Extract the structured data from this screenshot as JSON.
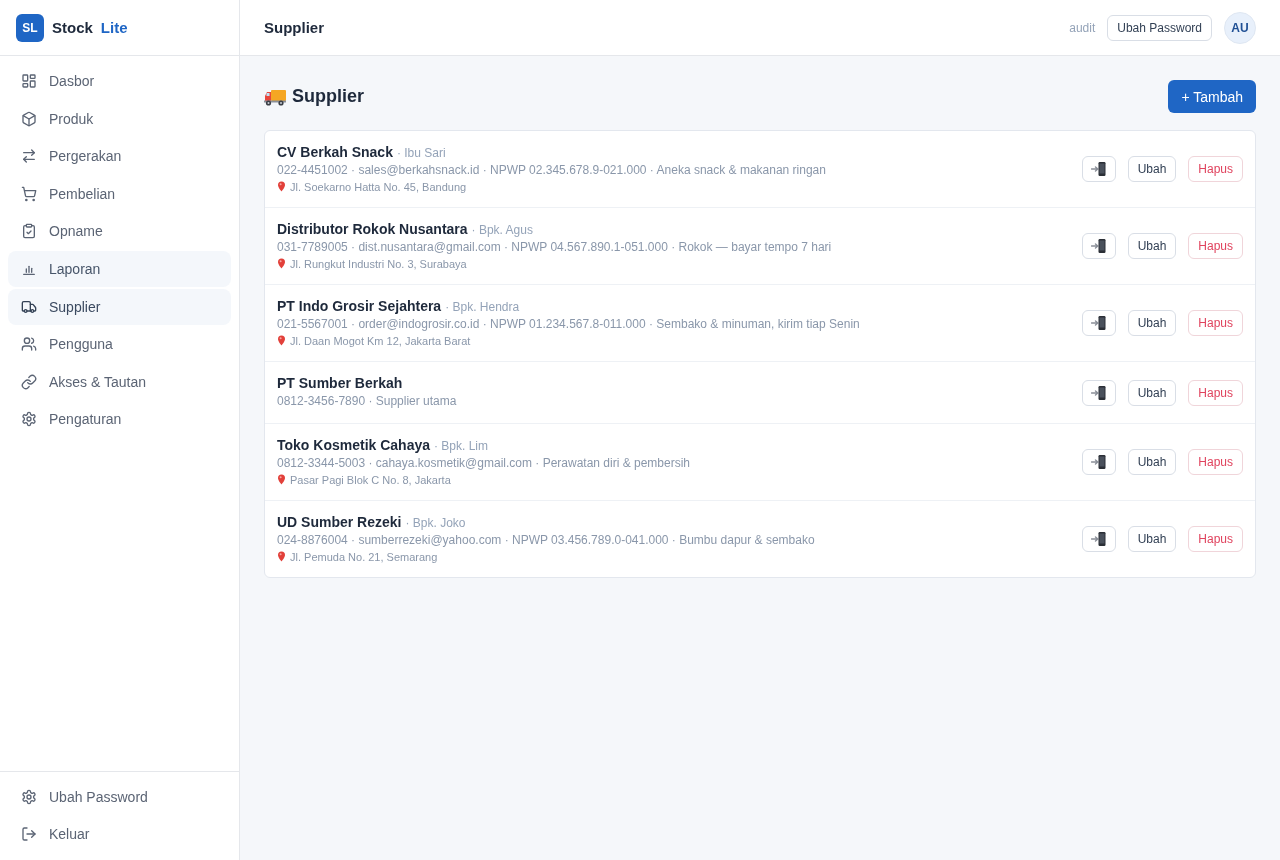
{
  "app": {
    "logo": "SL",
    "name": "Stock",
    "name_accent": "Lite"
  },
  "sidebar": {
    "items": [
      {
        "label": "Dasbor",
        "selected": false,
        "hovered": false
      },
      {
        "label": "Produk",
        "selected": false,
        "hovered": false
      },
      {
        "label": "Pergerakan",
        "selected": false,
        "hovered": false
      },
      {
        "label": "Pembelian",
        "selected": false,
        "hovered": false
      },
      {
        "label": "Opname",
        "selected": false,
        "hovered": false
      },
      {
        "label": "Laporan",
        "selected": false,
        "hovered": true
      },
      {
        "label": "Supplier",
        "selected": true,
        "hovered": false
      },
      {
        "label": "Pengguna",
        "selected": false,
        "hovered": false
      },
      {
        "label": "Akses & Tautan",
        "selected": false,
        "hovered": false
      },
      {
        "label": "Pengaturan",
        "selected": false,
        "hovered": false
      }
    ],
    "footer_items": [
      {
        "label": "Ubah Password"
      },
      {
        "label": "Keluar"
      }
    ]
  },
  "header": {
    "title": "Supplier",
    "user_role": "audit",
    "change_password_button": "Ubah Password",
    "avatar": "AU"
  },
  "page": {
    "title": "Supplier",
    "add_button": "+ Tambah"
  },
  "suppliers": [
    {
      "name": "CV Berkah Snack",
      "contact": "· Ibu Sari",
      "details": "022-4451002 · sales@berkahsnack.id · NPWP 02.345.678.9-021.000 · Aneka snack & makanan ringan",
      "address": "Jl. Soekarno Hatta No. 45, Bandung",
      "buttons": [
        {
          "kind": "edit",
          "label": "Ubah"
        },
        {
          "kind": "delete",
          "label": "Hapus"
        }
      ]
    },
    {
      "name": "Distributor Rokok Nusantara",
      "contact": "· Bpk. Agus",
      "details": "031-7789005 · dist.nusantara@gmail.com · NPWP 04.567.890.1-051.000 · Rokok — bayar tempo 7 hari",
      "address": "Jl. Rungkut Industri No. 3, Surabaya",
      "buttons": [
        {
          "kind": "edit",
          "label": "Ubah"
        },
        {
          "kind": "delete",
          "label": "Hapus"
        }
      ]
    },
    {
      "name": "PT Indo Grosir Sejahtera",
      "contact": "· Bpk. Hendra",
      "details": "021-5567001 · order@indogrosir.co.id · NPWP 01.234.567.8-011.000 · Sembako & minuman, kirim tiap Senin",
      "address": "Jl. Daan Mogot Km 12, Jakarta Barat",
      "buttons": [
        {
          "kind": "edit",
          "label": "Ubah"
        },
        {
          "kind": "delete",
          "label": "Hapus"
        }
      ]
    },
    {
      "name": "PT Sumber Berkah",
      "details": "0812-3456-7890 · Supplier utama",
      "buttons": [
        {
          "kind": "edit",
          "label": "Ubah"
        },
        {
          "kind": "delete",
          "label": "Hapus"
        }
      ]
    },
    {
      "name": "Toko Kosmetik Cahaya",
      "contact": "· Bpk. Lim",
      "details": "0812-3344-5003 · cahaya.kosmetik@gmail.com · Perawatan diri & pembersih",
      "address": "Pasar Pagi Blok C No. 8, Jakarta",
      "buttons": [
        {
          "kind": "edit",
          "label": "Ubah"
        },
        {
          "kind": "delete",
          "label": "Hapus"
        }
      ]
    },
    {
      "name": "UD Sumber Rezeki",
      "contact": "· Bpk. Joko",
      "details": "024-8876004 · sumberrezeki@yahoo.com · NPWP 03.456.789.0-041.000 · Bumbu dapur & sembako",
      "address": "Jl. Pemuda No. 21, Semarang",
      "buttons": [
        {
          "kind": "edit",
          "label": "Ubah"
        },
        {
          "kind": "delete",
          "label": "Hapus"
        }
      ]
    }
  ]
}
